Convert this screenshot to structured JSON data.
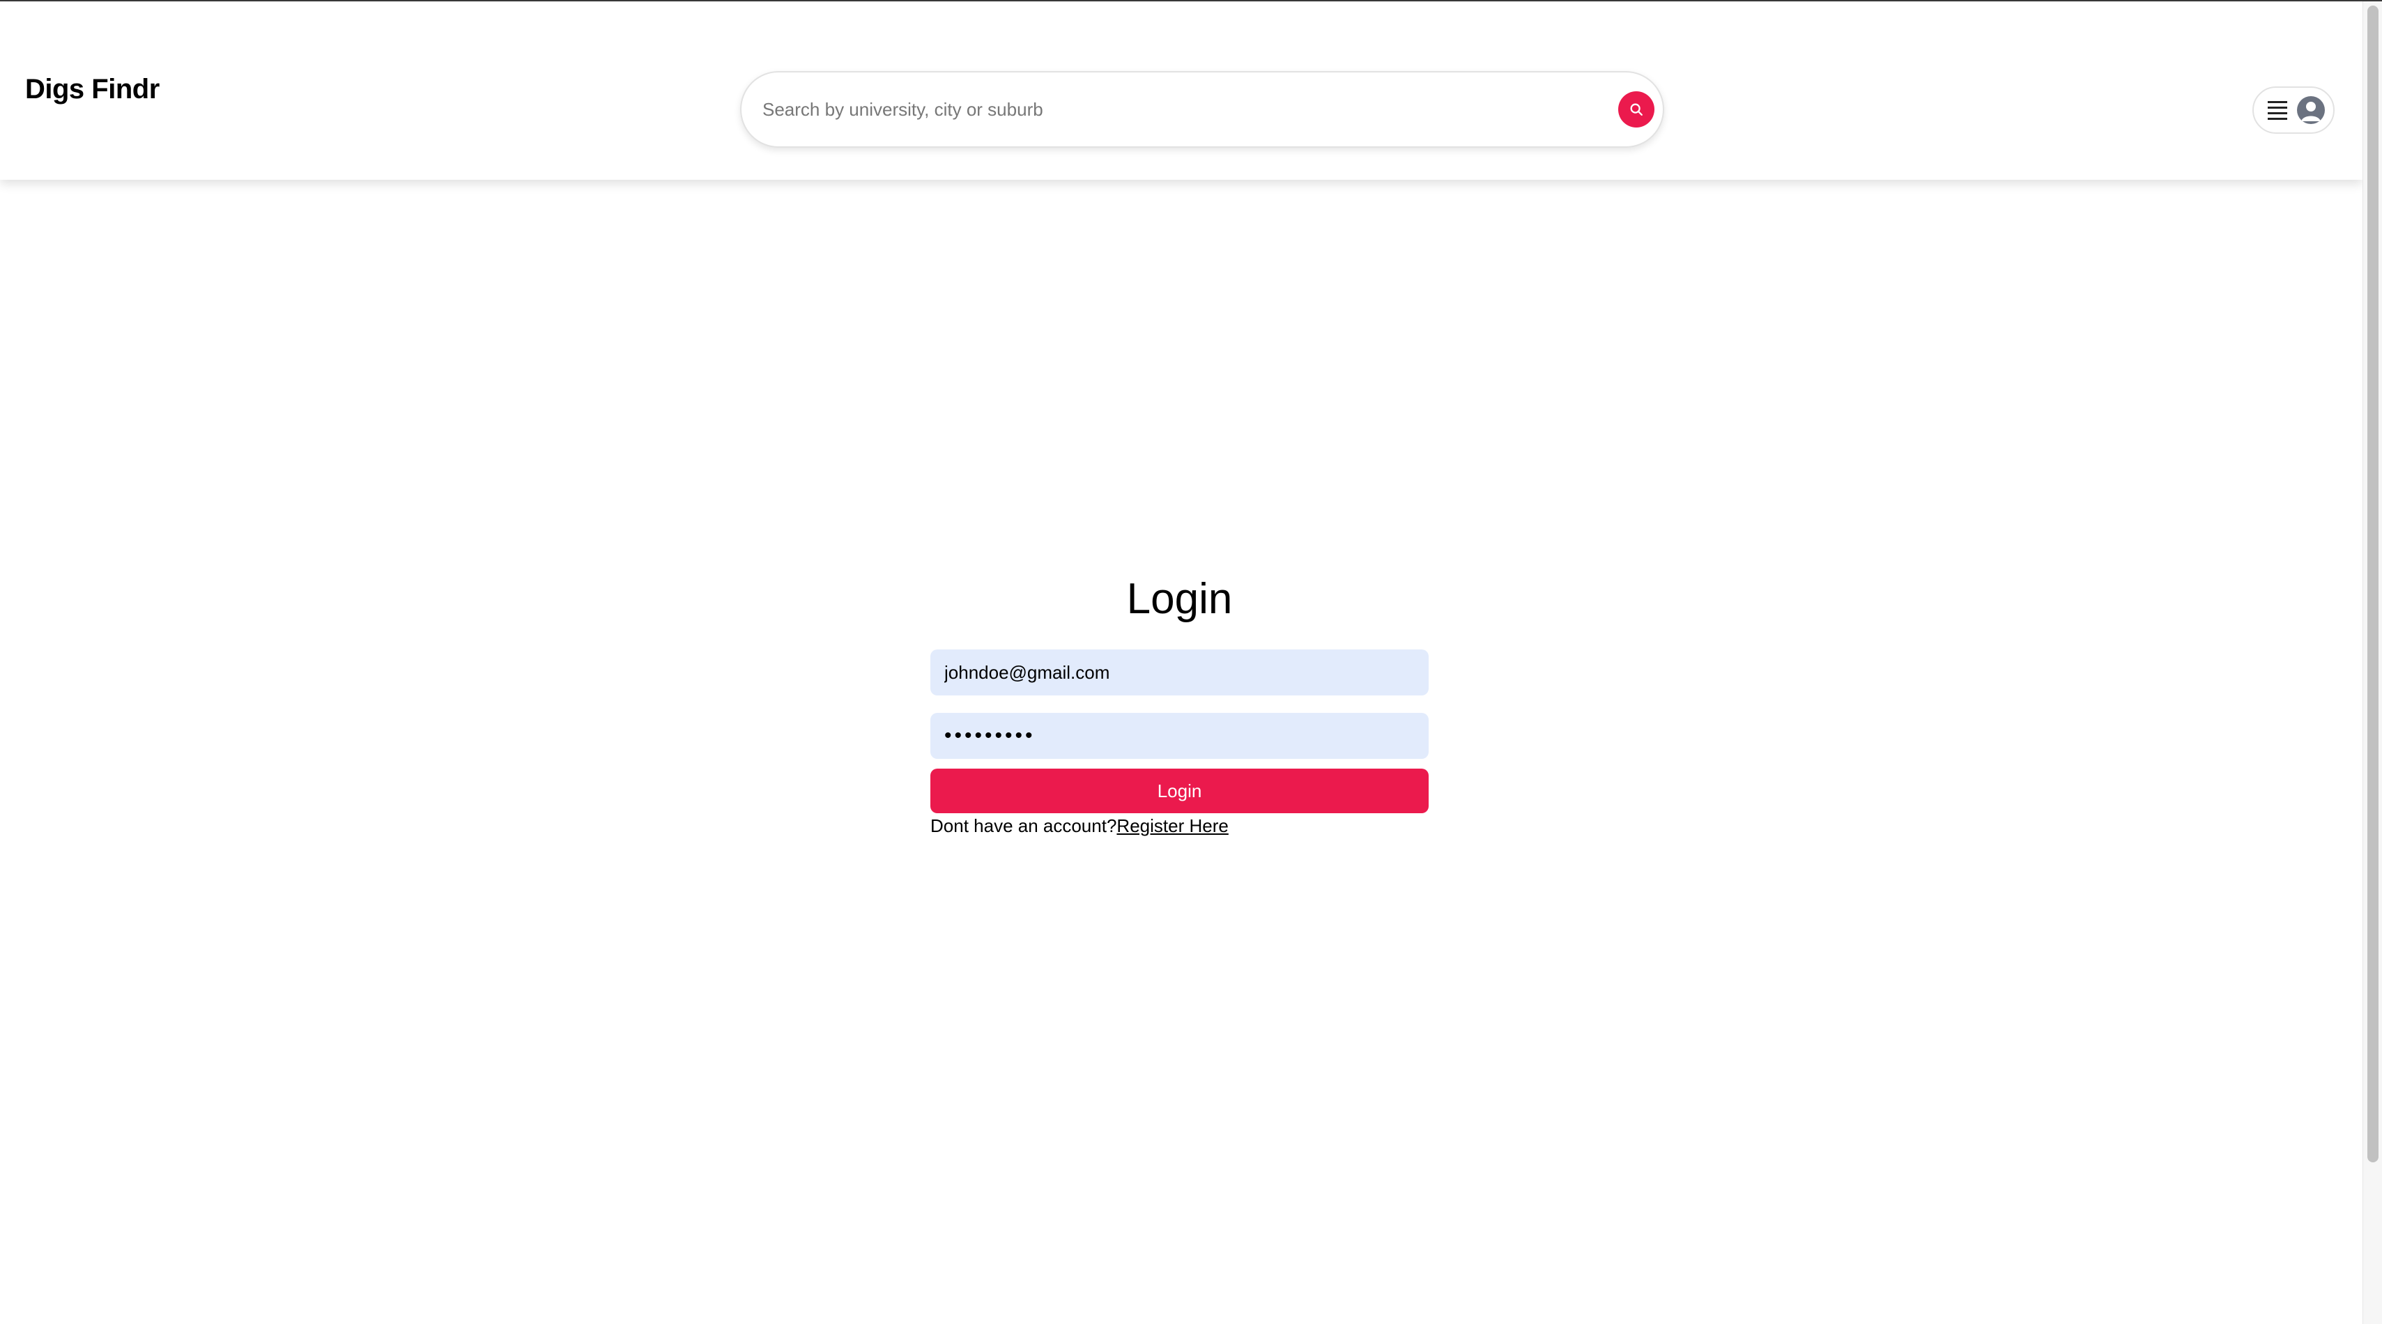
{
  "header": {
    "logo": "Digs Findr",
    "search_placeholder": "Search by university, city or suburb",
    "search_icon": "search-icon",
    "menu_icon": "hamburger-icon",
    "avatar_icon": "user-avatar-icon"
  },
  "login": {
    "title": "Login",
    "email_value": "johndoe@gmail.com",
    "password_value": "•••••••••",
    "button_label": "Login",
    "register_prompt": "Dont have an account?",
    "register_link": "Register Here"
  },
  "colors": {
    "accent": "#eb1a4d",
    "field_background": "#e2ebfc"
  }
}
